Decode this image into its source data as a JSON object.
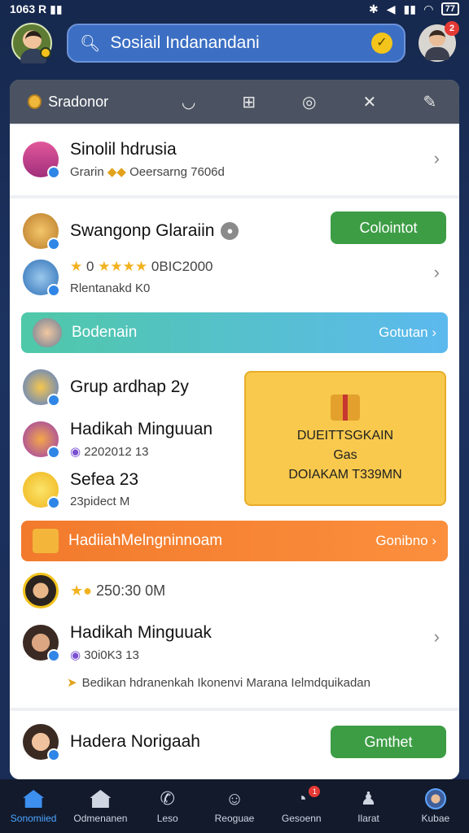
{
  "status_bar": {
    "time": "1063 R",
    "battery": "77"
  },
  "search": {
    "text": "Sosiail Indanandani"
  },
  "toolbar": {
    "title": "Sradonor"
  },
  "rows": {
    "r1": {
      "title": "Sinolil hdrusia",
      "sub": "Grarin",
      "sub2": "Oeersarng 7606d"
    },
    "r2": {
      "title": "Swangonp Glaraiin",
      "button": "Colointot",
      "sub": "0",
      "sub2": "0BIC2000",
      "meta": "Rlentanakd K0"
    },
    "banner1": {
      "label": "Bodenain",
      "action": "Gotutan"
    },
    "r3": {
      "title": "Grup ardhap 2y"
    },
    "r4": {
      "title": "Hadikah Minguuan",
      "sub": "2202012 13"
    },
    "r5": {
      "title": "Sefea 23",
      "sub": "23pidect M"
    },
    "gift": {
      "line1": "DUEITTSGKAIN",
      "line2": "Gas",
      "line3": "DOIAKAM T339MN"
    },
    "banner2": {
      "label": "HadiiahMelngninnoam",
      "action": "Gonibno"
    },
    "r6": {
      "sub": "250:30 0M"
    },
    "r7": {
      "title": "Hadikah Minguuak",
      "sub": "30i0K3 13",
      "note": "Bedikan hdranenkah Ikonenvi Marana Ielmdquikadan"
    },
    "r8": {
      "title": "Hadera Norigaah",
      "button": "Gmthet"
    }
  },
  "nav": [
    {
      "label": "Sonomiied",
      "icon": "home-icon"
    },
    {
      "label": "Odmenanen",
      "icon": "house-icon"
    },
    {
      "label": "Leso",
      "icon": "phone-icon"
    },
    {
      "label": "Reoguae",
      "icon": "people-icon"
    },
    {
      "label": "Gesoenn",
      "icon": "message-icon",
      "badge": "1"
    },
    {
      "label": "Ilarat",
      "icon": "person-icon"
    },
    {
      "label": "Kubae",
      "icon": "avatar-icon"
    }
  ],
  "colors": {
    "accent": "#3d9d45",
    "banner_blue": "#5fc7d8",
    "banner_orange": "#f68a35",
    "gift": "#f8c94d"
  }
}
